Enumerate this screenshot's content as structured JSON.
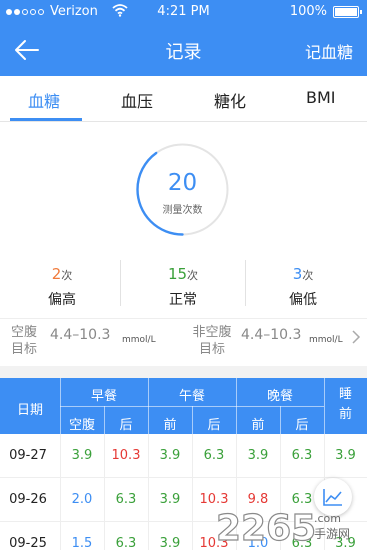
{
  "status_bar": {
    "carrier": "Verizon",
    "time": "4:21 PM",
    "battery": "100%"
  },
  "nav": {
    "title": "记录",
    "action": "记血糖"
  },
  "tabs": [
    {
      "label": "血糖",
      "active": true
    },
    {
      "label": "血压",
      "active": false
    },
    {
      "label": "糖化",
      "active": false
    },
    {
      "label": "BMI",
      "active": false
    }
  ],
  "summary": {
    "count": "20",
    "count_label": "测量次数",
    "progress_fraction": 0.4,
    "stats": [
      {
        "count": "2",
        "unit": "次",
        "label": "偏高",
        "color": "#f07a3b"
      },
      {
        "count": "15",
        "unit": "次",
        "label": "正常",
        "color": "#3aa03a"
      },
      {
        "count": "3",
        "unit": "次",
        "label": "偏低",
        "color": "#3d8ef3"
      }
    ],
    "ranges": [
      {
        "label_line1": "空腹",
        "label_line2": "目标",
        "value": "4.4–10.3",
        "unit": "mmol/L"
      },
      {
        "label_line1": "非空腹",
        "label_line2": "目标",
        "value": "4.4–10.3",
        "unit": "mmol/L"
      }
    ]
  },
  "table": {
    "headers": {
      "date": "日期",
      "breakfast": "早餐",
      "lunch": "午餐",
      "dinner": "晚餐",
      "sleep_line1": "睡",
      "sleep_line2": "前",
      "fasting": "空腹",
      "after1": "后",
      "before2": "前",
      "after2": "后",
      "before3": "前",
      "after3": "后"
    },
    "rows": [
      {
        "date": "09-27",
        "values": [
          [
            "3.9",
            "normal"
          ],
          [
            "10.3",
            "high"
          ],
          [
            "3.9",
            "normal"
          ],
          [
            "6.3",
            "normal"
          ],
          [
            "3.9",
            "normal"
          ],
          [
            "6.3",
            "normal"
          ],
          [
            "3.9",
            "normal"
          ]
        ]
      },
      {
        "date": "09-26",
        "values": [
          [
            "2.0",
            "low"
          ],
          [
            "6.3",
            "normal"
          ],
          [
            "3.9",
            "normal"
          ],
          [
            "10.3",
            "high"
          ],
          [
            "9.8",
            "high"
          ],
          [
            "6.3",
            "normal"
          ],
          [
            "",
            ""
          ]
        ]
      },
      {
        "date": "09-25",
        "values": [
          [
            "1.5",
            "low"
          ],
          [
            "6.3",
            "normal"
          ],
          [
            "3.9",
            "normal"
          ],
          [
            "10.3",
            "high"
          ],
          [
            "1.0",
            "low"
          ],
          [
            "6.3",
            "normal"
          ],
          [
            "3.9",
            "normal"
          ]
        ]
      }
    ]
  },
  "colors": {
    "primary": "#3d8ef3",
    "normal": "#3aa03a",
    "high": "#e53935",
    "high_count": "#f07a3b",
    "low": "#3d8ef3"
  },
  "icons": {
    "back": "arrow-left-icon",
    "chevron": "chevron-right-icon",
    "chart": "line-chart-icon",
    "wifi": "wifi-icon",
    "battery": "battery-icon"
  },
  "watermark": {
    "big": "2265",
    "domain": ".com",
    "small": "手游网"
  }
}
